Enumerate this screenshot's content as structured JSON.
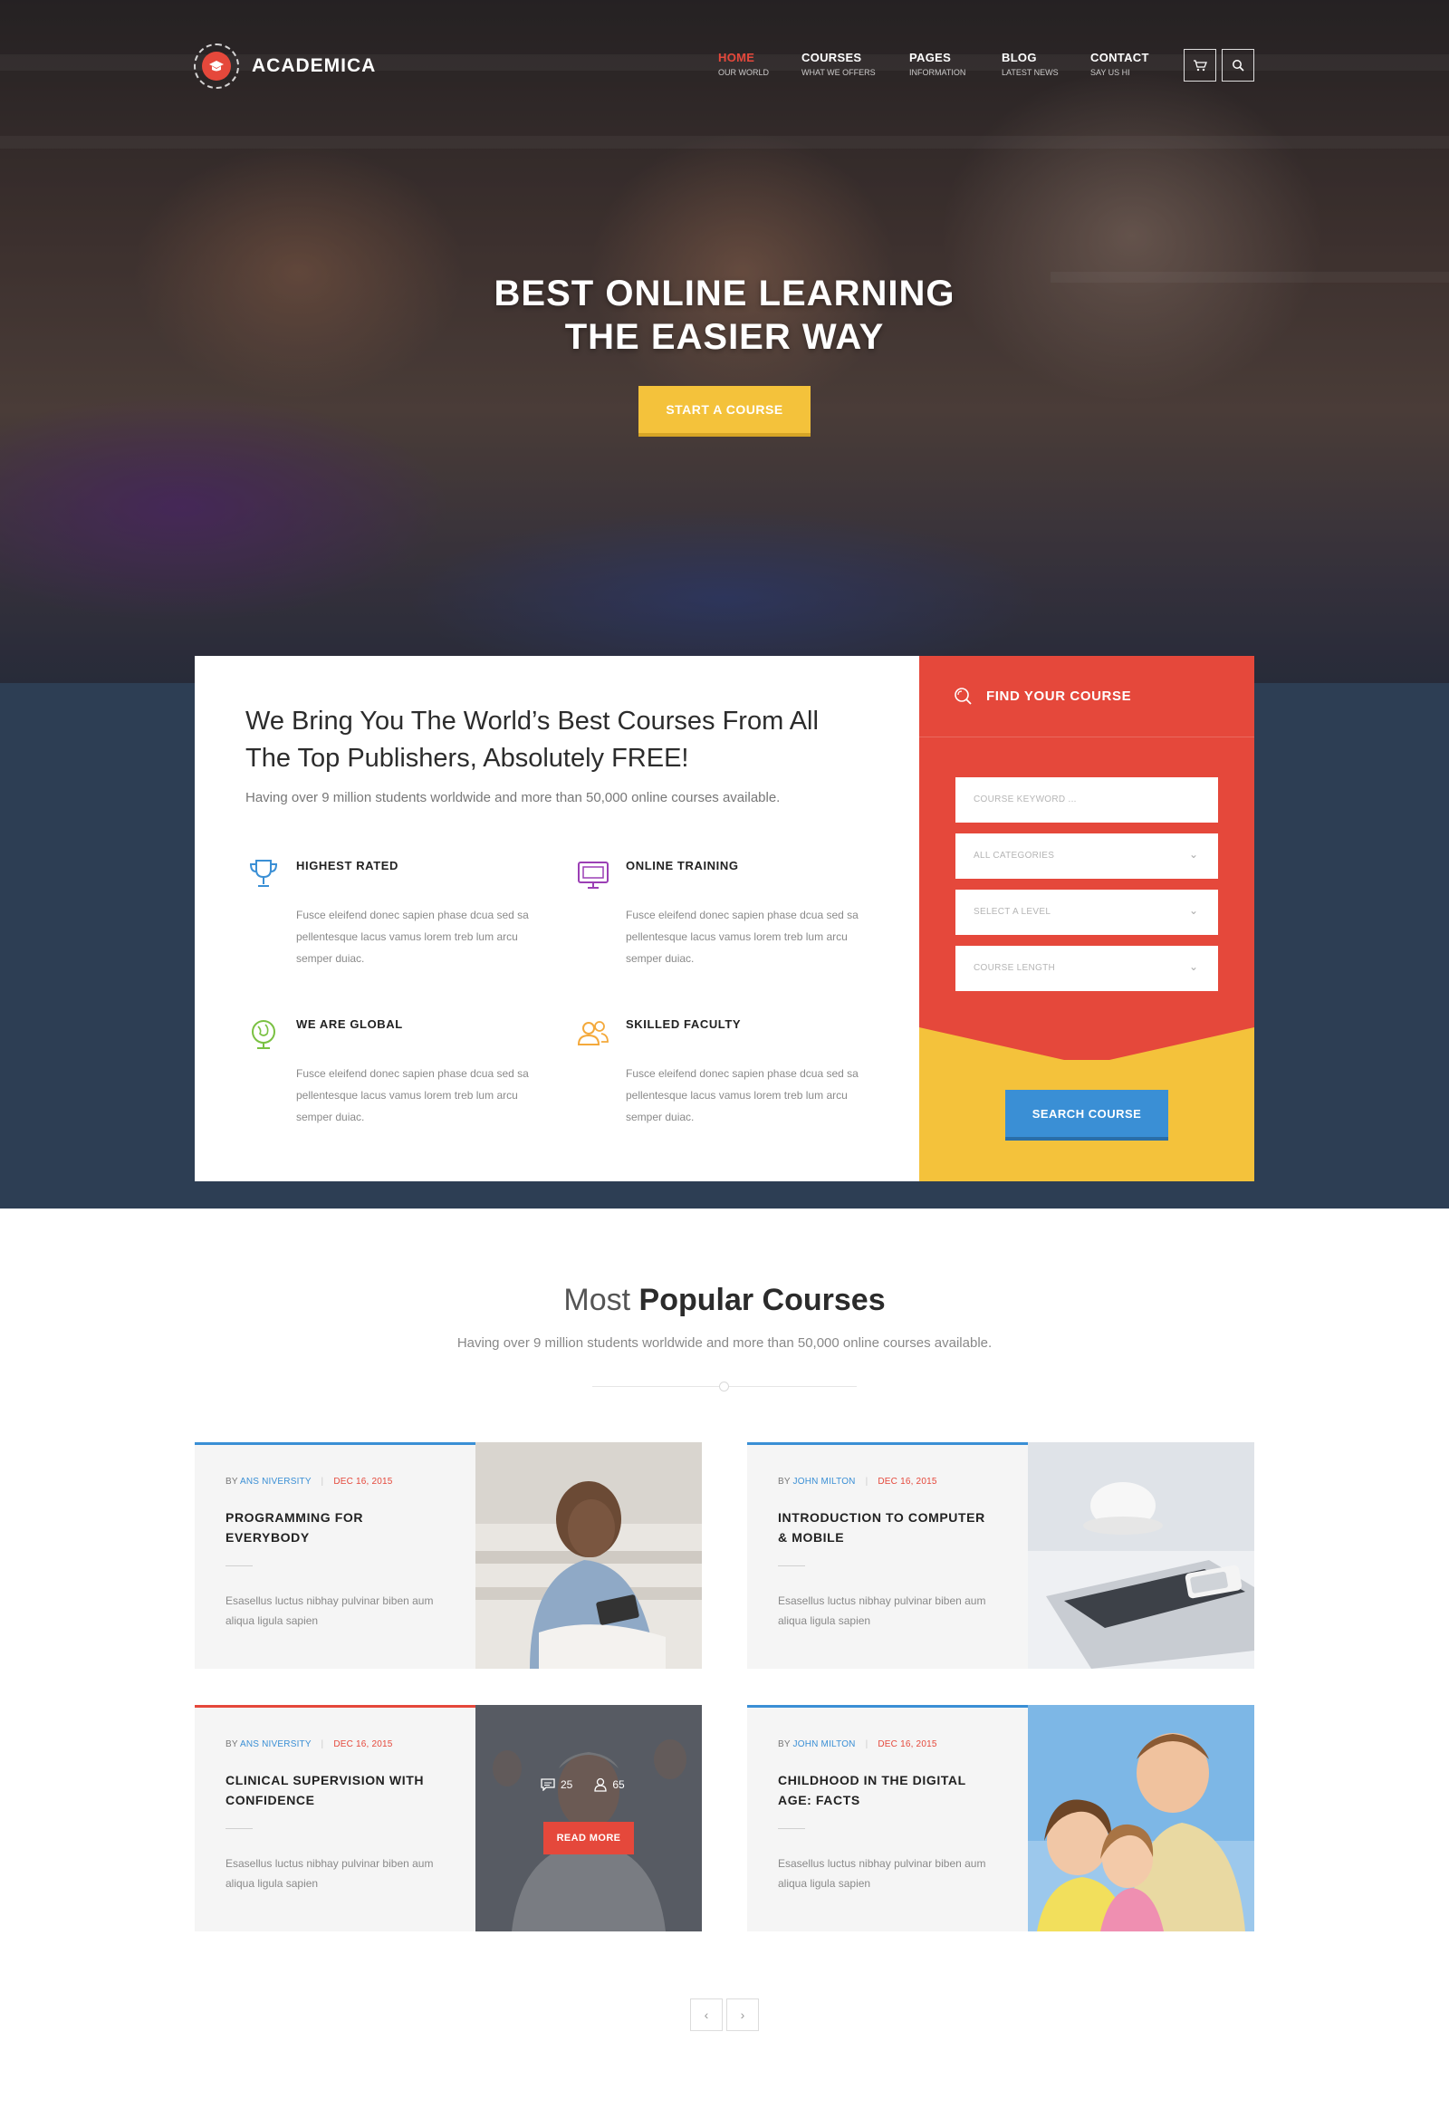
{
  "brand": {
    "name": "ACADEMICA"
  },
  "nav": {
    "items": [
      {
        "title": "HOME",
        "sub": "OUR WORLD"
      },
      {
        "title": "COURSES",
        "sub": "WHAT WE OFFERS"
      },
      {
        "title": "PAGES",
        "sub": "INFORMATION"
      },
      {
        "title": "BLOG",
        "sub": "LATEST NEWS"
      },
      {
        "title": "CONTACT",
        "sub": "SAY US HI"
      }
    ]
  },
  "hero": {
    "line1": "BEST ONLINE LEARNING",
    "line2": "THE EASIER WAY",
    "cta": "START A COURSE"
  },
  "intro": {
    "heading": "We Bring You The World’s Best Courses From All The Top Publishers, Absolutely FREE!",
    "sub": "Having over 9 million students worldwide and more than 50,000 online courses available."
  },
  "features": [
    {
      "title": "HIGHEST RATED",
      "desc": "Fusce eleifend donec sapien phase dcua sed sa pellentesque lacus vamus lorem treb lum arcu semper duiac."
    },
    {
      "title": "ONLINE TRAINING",
      "desc": "Fusce eleifend donec sapien phase dcua sed sa pellentesque lacus vamus lorem treb lum arcu semper duiac."
    },
    {
      "title": "WE ARE GLOBAL",
      "desc": "Fusce eleifend donec sapien phase dcua sed sa pellentesque lacus vamus lorem treb lum arcu semper duiac."
    },
    {
      "title": "SKILLED FACULTY",
      "desc": "Fusce eleifend donec sapien phase dcua sed sa pellentesque lacus vamus lorem treb lum arcu semper duiac."
    }
  ],
  "search": {
    "title": "FIND YOUR COURSE",
    "keyword_placeholder": "COURSE KEYWORD ...",
    "category": "ALL CATEGORIES",
    "level": "SELECT A LEVEL",
    "length": "COURSE LENGTH",
    "button": "SEARCH COURSE"
  },
  "popular": {
    "title_light": "Most",
    "title_bold": "Popular Courses",
    "sub": "Having over 9 million students worldwide and more than 50,000 online courses available."
  },
  "courses": [
    {
      "by": "BY",
      "author": "ANS NIVERSITY",
      "date": "DEC 16, 2015",
      "title": "PROGRAMMING FOR EVERYBODY",
      "desc": "Esasellus luctus nibhay pulvinar biben aum aliqua ligula sapien"
    },
    {
      "by": "BY",
      "author": "JOHN MILTON",
      "date": "DEC 16, 2015",
      "title": "INTRODUCTION TO COMPUTER & MOBILE",
      "desc": "Esasellus luctus nibhay pulvinar biben aum aliqua ligula sapien"
    },
    {
      "by": "BY",
      "author": "ANS NIVERSITY",
      "date": "DEC 16, 2015",
      "title": "CLINICAL SUPERVISION WITH CONFIDENCE",
      "desc": "Esasellus luctus nibhay pulvinar biben aum aliqua ligula sapien",
      "comments": "25",
      "students": "65",
      "read_more": "READ MORE"
    },
    {
      "by": "BY",
      "author": "JOHN MILTON",
      "date": "DEC 16, 2015",
      "title": "CHILDHOOD IN THE DIGITAL AGE: FACTS",
      "desc": "Esasellus luctus nibhay pulvinar biben aum aliqua ligula sapien"
    }
  ],
  "pager": {
    "prev": "‹",
    "next": "›"
  },
  "colors": {
    "accent_red": "#e5483b",
    "accent_yellow": "#f4c23b",
    "accent_blue": "#3a8fd5",
    "navy": "#2d3e54"
  }
}
